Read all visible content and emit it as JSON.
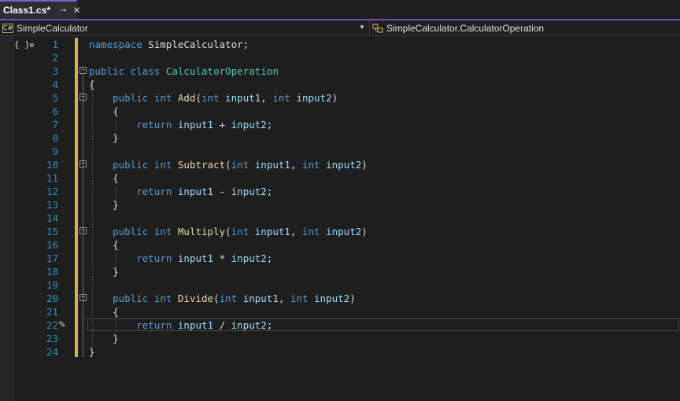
{
  "tab": {
    "title": "Class1.cs*",
    "pin_glyph": "⊸",
    "close_glyph": "✕"
  },
  "navbar": {
    "left_icon": "C#",
    "left_label": "SimpleCalculator",
    "right_label": "SimpleCalculator.CalculatorOperation"
  },
  "editor": {
    "lines": [
      {
        "n": "1",
        "tokens": [
          {
            "t": "kw",
            "v": "namespace"
          },
          {
            "t": "plain",
            "v": " SimpleCalculator;"
          }
        ]
      },
      {
        "n": "2",
        "tokens": []
      },
      {
        "n": "3",
        "tokens": [
          {
            "t": "kw",
            "v": "public"
          },
          {
            "t": "plain",
            "v": " "
          },
          {
            "t": "kw",
            "v": "class"
          },
          {
            "t": "plain",
            "v": " "
          },
          {
            "t": "type",
            "v": "CalculatorOperation"
          }
        ]
      },
      {
        "n": "4",
        "tokens": [
          {
            "t": "plain",
            "v": "{"
          }
        ]
      },
      {
        "n": "5",
        "tokens": [
          {
            "t": "plain",
            "v": "    "
          },
          {
            "t": "kw",
            "v": "public"
          },
          {
            "t": "plain",
            "v": " "
          },
          {
            "t": "kw",
            "v": "int"
          },
          {
            "t": "plain",
            "v": " "
          },
          {
            "t": "fn",
            "v": "Add"
          },
          {
            "t": "plain",
            "v": "("
          },
          {
            "t": "kw",
            "v": "int"
          },
          {
            "t": "plain",
            "v": " "
          },
          {
            "t": "id",
            "v": "input1"
          },
          {
            "t": "plain",
            "v": ", "
          },
          {
            "t": "kw",
            "v": "int"
          },
          {
            "t": "plain",
            "v": " "
          },
          {
            "t": "id",
            "v": "input2"
          },
          {
            "t": "plain",
            "v": ")"
          }
        ]
      },
      {
        "n": "6",
        "tokens": [
          {
            "t": "plain",
            "v": "    {"
          }
        ]
      },
      {
        "n": "7",
        "tokens": [
          {
            "t": "plain",
            "v": "        "
          },
          {
            "t": "kw",
            "v": "return"
          },
          {
            "t": "plain",
            "v": " "
          },
          {
            "t": "id",
            "v": "input1"
          },
          {
            "t": "plain",
            "v": " + "
          },
          {
            "t": "id",
            "v": "input2"
          },
          {
            "t": "plain",
            "v": ";"
          }
        ]
      },
      {
        "n": "8",
        "tokens": [
          {
            "t": "plain",
            "v": "    }"
          }
        ]
      },
      {
        "n": "9",
        "tokens": []
      },
      {
        "n": "10",
        "tokens": [
          {
            "t": "plain",
            "v": "    "
          },
          {
            "t": "kw",
            "v": "public"
          },
          {
            "t": "plain",
            "v": " "
          },
          {
            "t": "kw",
            "v": "int"
          },
          {
            "t": "plain",
            "v": " "
          },
          {
            "t": "fn",
            "v": "Subtract"
          },
          {
            "t": "plain",
            "v": "("
          },
          {
            "t": "kw",
            "v": "int"
          },
          {
            "t": "plain",
            "v": " "
          },
          {
            "t": "id",
            "v": "input1"
          },
          {
            "t": "plain",
            "v": ", "
          },
          {
            "t": "kw",
            "v": "int"
          },
          {
            "t": "plain",
            "v": " "
          },
          {
            "t": "id",
            "v": "input2"
          },
          {
            "t": "plain",
            "v": ")"
          }
        ]
      },
      {
        "n": "11",
        "tokens": [
          {
            "t": "plain",
            "v": "    {"
          }
        ]
      },
      {
        "n": "12",
        "tokens": [
          {
            "t": "plain",
            "v": "        "
          },
          {
            "t": "kw",
            "v": "return"
          },
          {
            "t": "plain",
            "v": " "
          },
          {
            "t": "id",
            "v": "input1"
          },
          {
            "t": "plain",
            "v": " - "
          },
          {
            "t": "id",
            "v": "input2"
          },
          {
            "t": "plain",
            "v": ";"
          }
        ]
      },
      {
        "n": "13",
        "tokens": [
          {
            "t": "plain",
            "v": "    }"
          }
        ]
      },
      {
        "n": "14",
        "tokens": []
      },
      {
        "n": "15",
        "tokens": [
          {
            "t": "plain",
            "v": "    "
          },
          {
            "t": "kw",
            "v": "public"
          },
          {
            "t": "plain",
            "v": " "
          },
          {
            "t": "kw",
            "v": "int"
          },
          {
            "t": "plain",
            "v": " "
          },
          {
            "t": "fn",
            "v": "Multiply"
          },
          {
            "t": "plain",
            "v": "("
          },
          {
            "t": "kw",
            "v": "int"
          },
          {
            "t": "plain",
            "v": " "
          },
          {
            "t": "id",
            "v": "input1"
          },
          {
            "t": "plain",
            "v": ", "
          },
          {
            "t": "kw",
            "v": "int"
          },
          {
            "t": "plain",
            "v": " "
          },
          {
            "t": "id",
            "v": "input2"
          },
          {
            "t": "plain",
            "v": ")"
          }
        ]
      },
      {
        "n": "16",
        "tokens": [
          {
            "t": "plain",
            "v": "    {"
          }
        ]
      },
      {
        "n": "17",
        "tokens": [
          {
            "t": "plain",
            "v": "        "
          },
          {
            "t": "kw",
            "v": "return"
          },
          {
            "t": "plain",
            "v": " "
          },
          {
            "t": "id",
            "v": "input1"
          },
          {
            "t": "plain",
            "v": " * "
          },
          {
            "t": "id",
            "v": "input2"
          },
          {
            "t": "plain",
            "v": ";"
          }
        ]
      },
      {
        "n": "18",
        "tokens": [
          {
            "t": "plain",
            "v": "    }"
          }
        ]
      },
      {
        "n": "19",
        "tokens": []
      },
      {
        "n": "20",
        "tokens": [
          {
            "t": "plain",
            "v": "    "
          },
          {
            "t": "kw",
            "v": "public"
          },
          {
            "t": "plain",
            "v": " "
          },
          {
            "t": "kw",
            "v": "int"
          },
          {
            "t": "plain",
            "v": " "
          },
          {
            "t": "fn",
            "v": "Divide"
          },
          {
            "t": "plain",
            "v": "("
          },
          {
            "t": "kw",
            "v": "int"
          },
          {
            "t": "plain",
            "v": " "
          },
          {
            "t": "id",
            "v": "input1"
          },
          {
            "t": "plain",
            "v": ", "
          },
          {
            "t": "kw",
            "v": "int"
          },
          {
            "t": "plain",
            "v": " "
          },
          {
            "t": "id",
            "v": "input2"
          },
          {
            "t": "plain",
            "v": ")"
          }
        ]
      },
      {
        "n": "21",
        "tokens": [
          {
            "t": "plain",
            "v": "    {"
          }
        ]
      },
      {
        "n": "22",
        "tokens": [
          {
            "t": "plain",
            "v": "        "
          },
          {
            "t": "kw",
            "v": "return"
          },
          {
            "t": "plain",
            "v": " "
          },
          {
            "t": "id",
            "v": "input1"
          },
          {
            "t": "plain",
            "v": " / "
          },
          {
            "t": "id",
            "v": "input2"
          },
          {
            "t": "plain",
            "v": ";"
          }
        ]
      },
      {
        "n": "23",
        "tokens": [
          {
            "t": "plain",
            "v": "    }"
          }
        ]
      },
      {
        "n": "24",
        "tokens": [
          {
            "t": "plain",
            "v": "}"
          }
        ]
      }
    ],
    "current_line": "22"
  }
}
